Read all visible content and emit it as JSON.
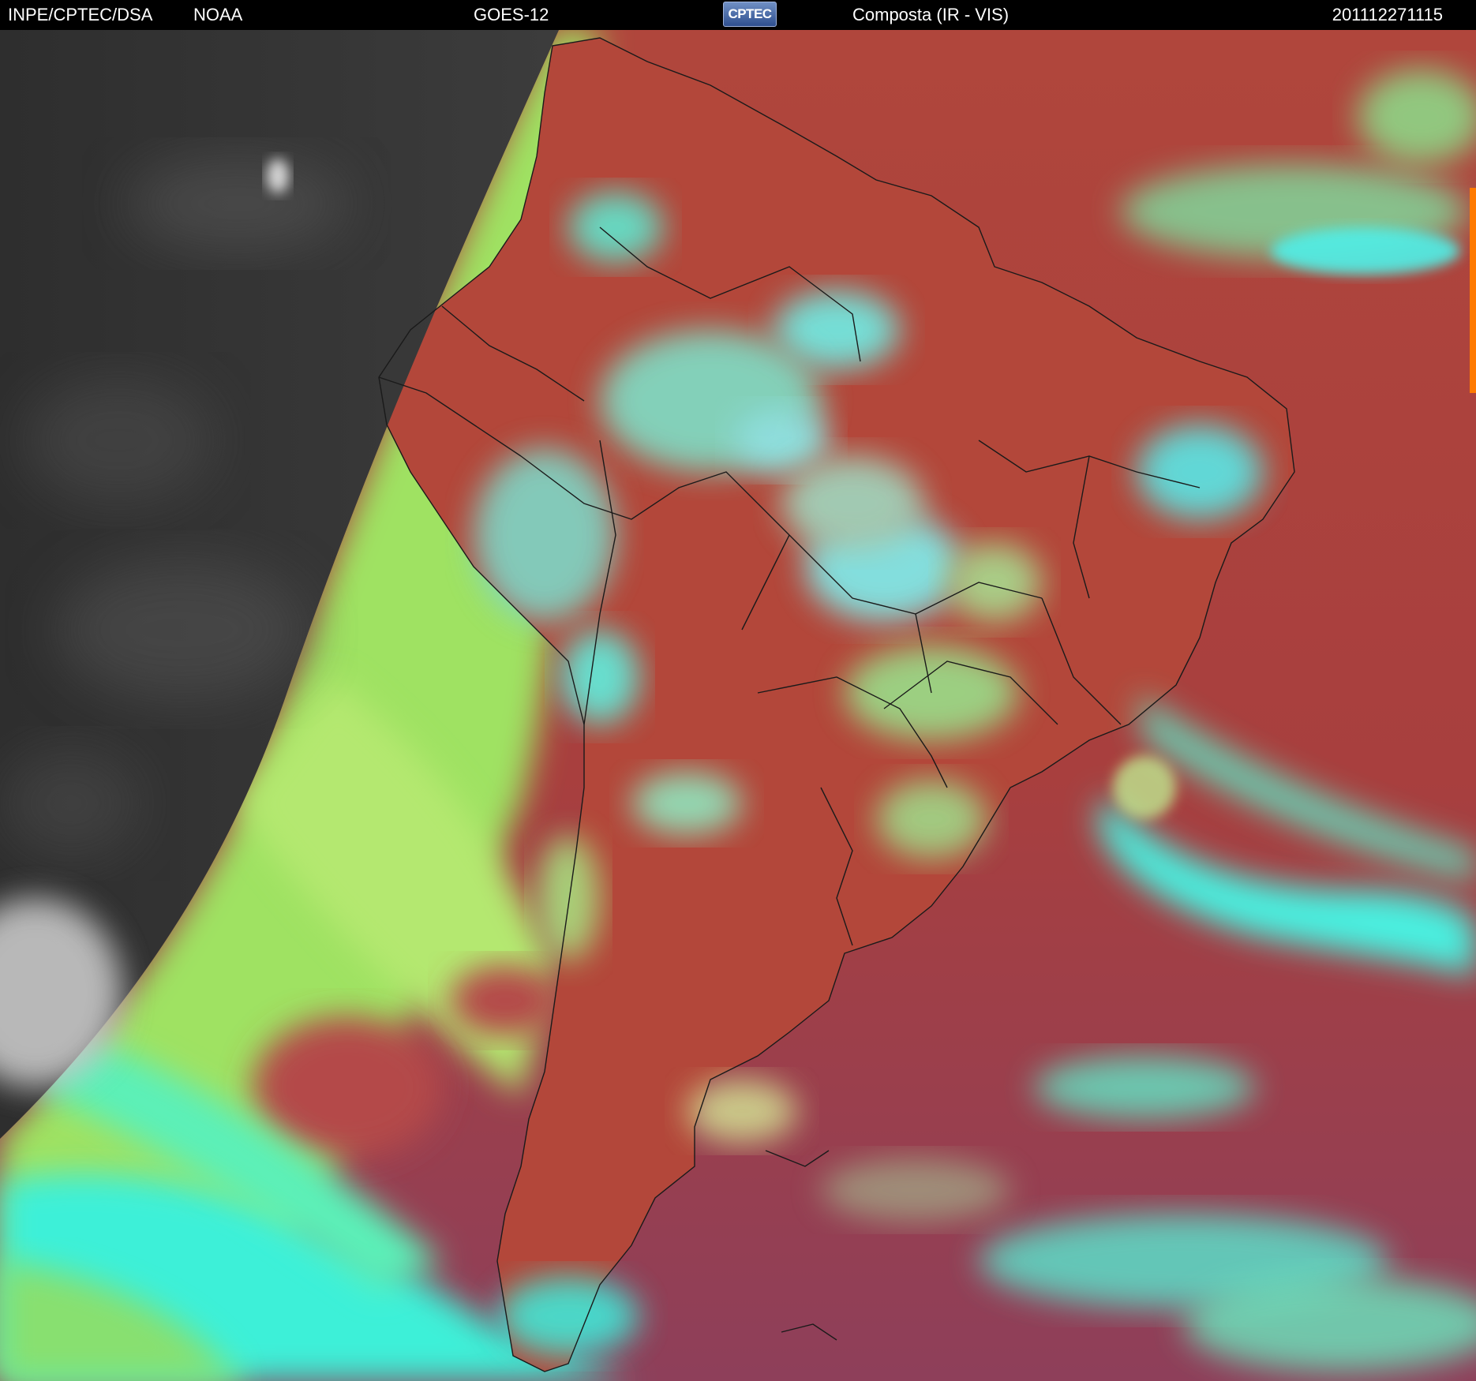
{
  "header": {
    "org": "INPE/CPTEC/DSA",
    "agency": "NOAA",
    "satellite": "GOES-12",
    "logo_text": "CPTEC",
    "product": "Composta (IR - VIS)",
    "timestamp": "201112271115"
  },
  "colors": {
    "background": "#000000",
    "night_side": "#3a3a3a",
    "ocean_composite": "#a8423c",
    "land_composite": "#b5473a",
    "green_cloud": "#a2e860",
    "cyan_cloud": "#39f0e0",
    "border_lines": "#1a1a1a"
  }
}
